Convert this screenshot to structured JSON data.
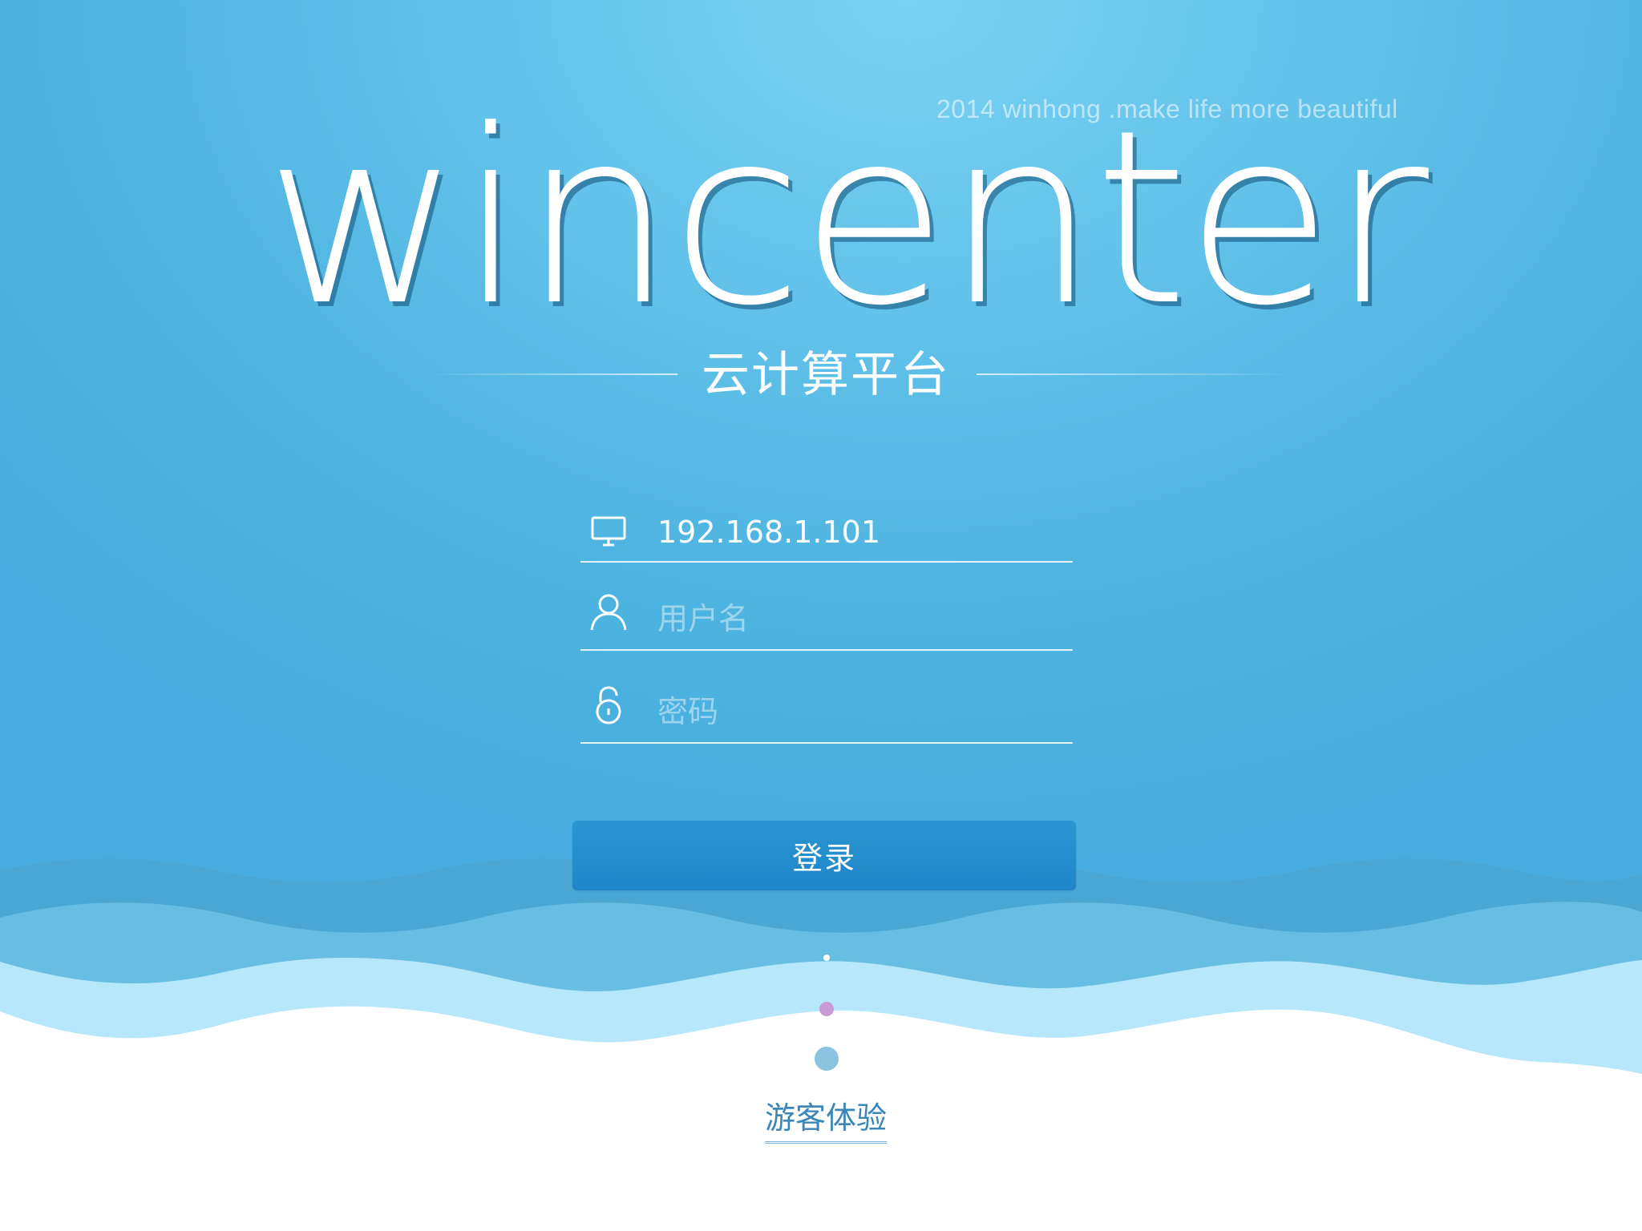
{
  "branding": {
    "tagline": "2014 winhong .make life more beautiful",
    "logo_text": "wincenter",
    "subtitle": "云计算平台"
  },
  "login_form": {
    "server": {
      "value": "192.168.1.101",
      "icon": "monitor-icon"
    },
    "username": {
      "placeholder": "用户名",
      "icon": "user-icon"
    },
    "password": {
      "placeholder": "密码",
      "icon": "lock-icon"
    },
    "submit_label": "登录"
  },
  "guest_link_label": "游客体验",
  "colors": {
    "background": "#4db3df",
    "button": "#1f86c7",
    "guest_link": "#3a86b8",
    "wave_dark": "#4aa7d4",
    "wave_mid": "#68bde2",
    "wave_light": "#b6e7fb"
  }
}
